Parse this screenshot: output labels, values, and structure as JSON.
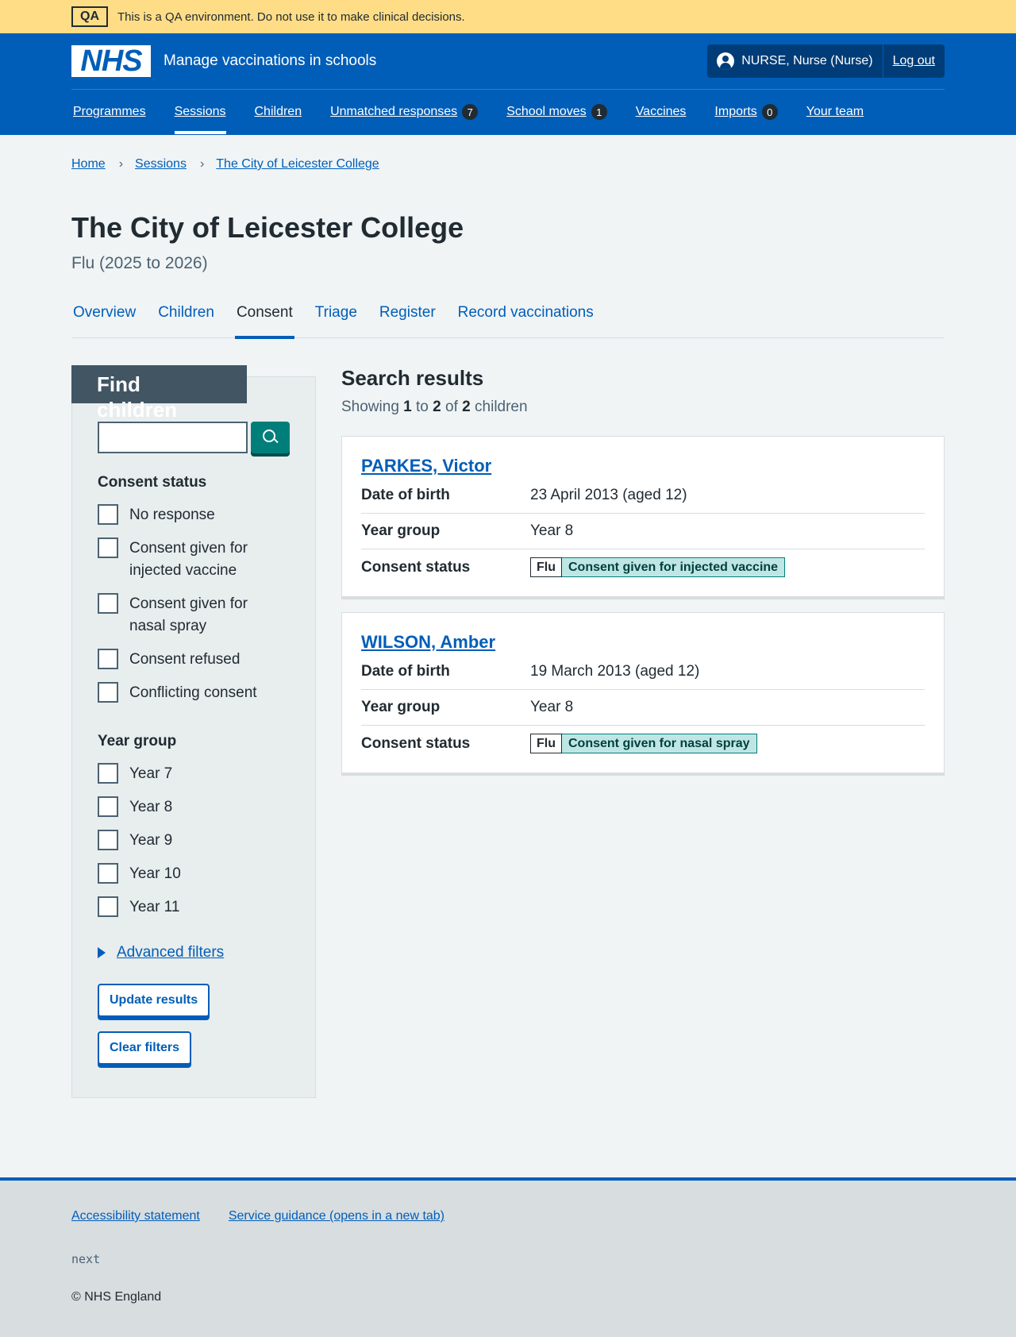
{
  "qa_banner": {
    "tag": "QA",
    "text": "This is a QA environment. Do not use it to make clinical decisions."
  },
  "header": {
    "logo": "NHS",
    "service_name": "Manage vaccinations in schools",
    "user": "NURSE, Nurse (Nurse)",
    "logout": "Log out",
    "nav": [
      {
        "label": "Programmes"
      },
      {
        "label": "Sessions"
      },
      {
        "label": "Children"
      },
      {
        "label": "Unmatched responses",
        "badge": "7"
      },
      {
        "label": "School moves",
        "badge": "1"
      },
      {
        "label": "Vaccines"
      },
      {
        "label": "Imports",
        "badge": "0"
      },
      {
        "label": "Your team"
      }
    ]
  },
  "breadcrumb": [
    "Home",
    "Sessions",
    "The City of Leicester College"
  ],
  "page": {
    "title": "The City of Leicester College",
    "caption": "Flu (2025 to 2026)"
  },
  "tabs": [
    "Overview",
    "Children",
    "Consent",
    "Triage",
    "Register",
    "Record vaccinations"
  ],
  "filters": {
    "heading": "Find children",
    "consent_legend": "Consent status",
    "consent_options": [
      "No response",
      "Consent given for injected vaccine",
      "Consent given for nasal spray",
      "Consent refused",
      "Conflicting consent"
    ],
    "year_legend": "Year group",
    "year_options": [
      "Year 7",
      "Year 8",
      "Year 9",
      "Year 10",
      "Year 11"
    ],
    "advanced": "Advanced filters",
    "update_button": "Update results",
    "clear_button": "Clear filters"
  },
  "results": {
    "heading": "Search results",
    "showing_prefix": "Showing",
    "from": "1",
    "to_word": "to",
    "to": "2",
    "of_word": "of",
    "total": "2",
    "unit": "children",
    "labels": {
      "dob": "Date of birth",
      "year": "Year group",
      "consent": "Consent status"
    },
    "children": [
      {
        "name": "PARKES, Victor",
        "dob": "23 April 2013 (aged 12)",
        "year": "Year 8",
        "programme": "Flu",
        "status": "Consent given for injected vaccine"
      },
      {
        "name": "WILSON, Amber",
        "dob": "19 March 2013 (aged 12)",
        "year": "Year 8",
        "programme": "Flu",
        "status": "Consent given for nasal spray"
      }
    ]
  },
  "footer": {
    "links": [
      "Accessibility statement",
      "Service guidance (opens in a new tab)"
    ],
    "next": "next",
    "copyright": "© NHS England"
  },
  "colors": {
    "nhs_blue": "#005eb8",
    "qa_yellow": "#ffdd87",
    "aqua_green": "#007f7a",
    "dark_blue": "#003d78"
  }
}
